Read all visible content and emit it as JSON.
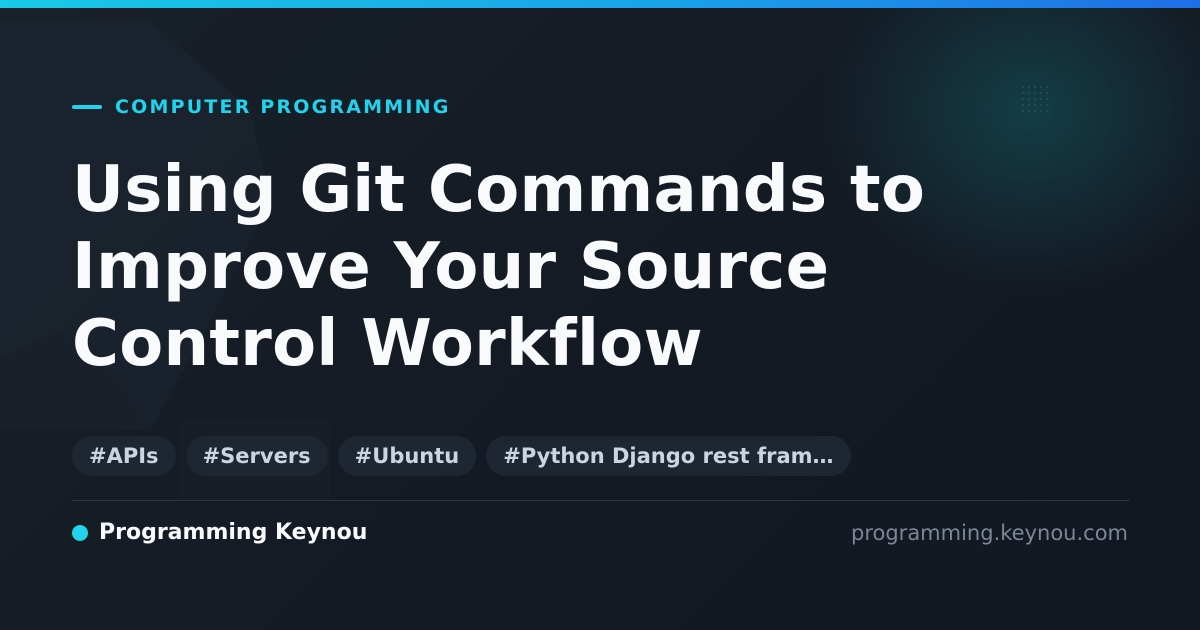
{
  "category": "COMPUTER PROGRAMMING",
  "headline": {
    "lines": [
      "Using Git Commands to",
      "Improve Your Source",
      "Control Workflow"
    ]
  },
  "tags": [
    "#APIs",
    "#Servers",
    "#Ubuntu",
    "#Python Django rest fram…"
  ],
  "footer": {
    "brand": "Programming Keynou",
    "url": "programming.keynou.com"
  },
  "colors": {
    "accent": "#22d3ee",
    "background": "#141a23",
    "headline": "#f8fafc",
    "tag_background": "#1e2731",
    "tag_text": "#cbd5e1",
    "url_text": "#7c8794"
  },
  "icons": {
    "category_marker": "accent-dash-icon",
    "brand_marker": "brand-dot-icon"
  }
}
